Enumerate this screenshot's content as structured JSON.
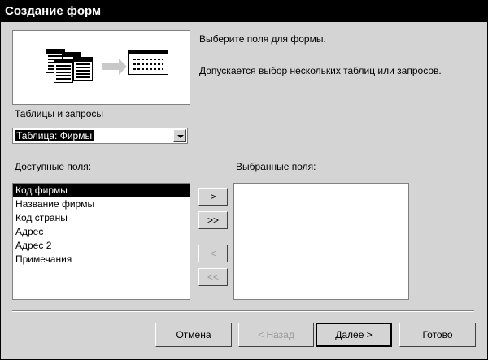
{
  "window": {
    "title": "Создание форм"
  },
  "description": {
    "line1": "Выберите поля для формы.",
    "line2": "Допускается выбор нескольких таблиц или запросов."
  },
  "source": {
    "label": "Таблицы и запросы",
    "selected": "Таблица: Фирмы"
  },
  "available": {
    "label": "Доступные поля:",
    "items": [
      {
        "text": "Код фирмы",
        "selected": true
      },
      {
        "text": "Название фирмы"
      },
      {
        "text": "Код страны"
      },
      {
        "text": "Адрес"
      },
      {
        "text": "Адрес 2"
      },
      {
        "text": "Примечания"
      }
    ]
  },
  "selected_fields": {
    "label": "Выбранные поля:"
  },
  "move_buttons": {
    "add_one": ">",
    "add_all": ">>",
    "remove_one": "<",
    "remove_all": "<<"
  },
  "footer": {
    "cancel": "Отмена",
    "back": "< Назад",
    "next": "Далее >",
    "finish": "Готово"
  },
  "icons": {
    "illustration": "table-to-form-illustration",
    "dropdown": "chevron-down-icon"
  }
}
